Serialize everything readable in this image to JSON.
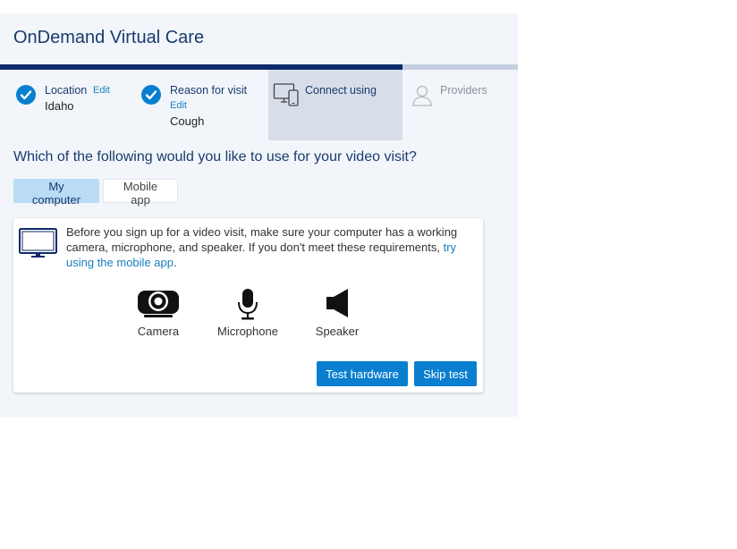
{
  "app": {
    "title": "OnDemand Virtual Care"
  },
  "progress": {
    "fraction": 0.777
  },
  "steps": [
    {
      "label": "Location",
      "edit_label": "Edit",
      "value": "Idaho",
      "status": "complete",
      "icon": "check-icon"
    },
    {
      "label": "Reason for visit",
      "edit_label": "Edit",
      "value": "Cough",
      "status": "complete",
      "icon": "check-icon"
    },
    {
      "label": "Connect using",
      "status": "active",
      "icon": "devices-icon"
    },
    {
      "label": "Providers",
      "status": "pending",
      "icon": "person-icon"
    }
  ],
  "question": "Which of the following would you like to use for your video visit?",
  "options": {
    "selected": "My computer",
    "items": [
      "My computer",
      "Mobile app"
    ]
  },
  "requirements": {
    "text": "Before you sign up for a video visit, make sure your computer has a working camera, microphone, and speaker. If you don't meet these requirements, ",
    "link_text": "try using the mobile app",
    "suffix": ".",
    "icon": "monitor-icon",
    "devices": [
      {
        "label": "Camera",
        "icon": "camera-icon"
      },
      {
        "label": "Microphone",
        "icon": "microphone-icon"
      },
      {
        "label": "Speaker",
        "icon": "speaker-icon"
      }
    ],
    "test_label": "Test hardware",
    "skip_label": "Skip test"
  },
  "colors": {
    "primary": "#0a7fd0",
    "title": "#1a3a6e",
    "progress_fill": "#0d2a6b",
    "progress_track": "#c5cde0",
    "active_step": "#d7deea",
    "panel": "#f2f6fa",
    "selected_option": "#b9dcf4"
  }
}
